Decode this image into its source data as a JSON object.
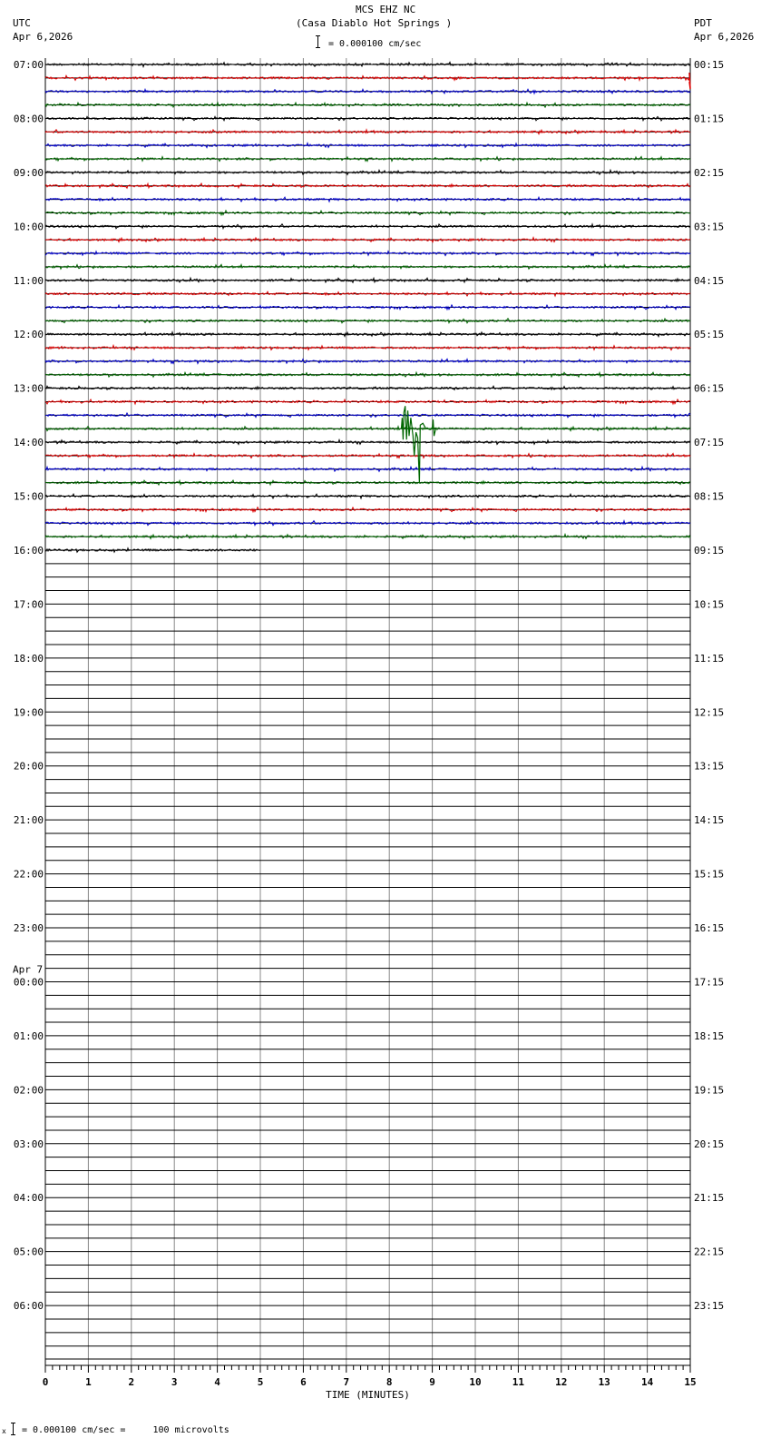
{
  "header": {
    "title": "MCS EHZ NC",
    "subtitle": "(Casa Diablo Hot Springs )",
    "scale": "= 0.000100 cm/sec",
    "left_tz": "UTC",
    "left_date": "Apr 6,2026",
    "right_tz": "PDT",
    "right_date": "Apr 6,2026"
  },
  "footer": {
    "scale_note": "= 0.000100 cm/sec =     100 microvolts",
    "marker": "x"
  },
  "chart_data": {
    "type": "line",
    "title": "MCS EHZ NC (Casa Diablo Hot Springs )",
    "xlabel": "TIME (MINUTES)",
    "xlim": [
      0,
      15
    ],
    "x_ticks": [
      "0",
      "1",
      "2",
      "3",
      "4",
      "5",
      "6",
      "7",
      "8",
      "9",
      "10",
      "11",
      "12",
      "13",
      "14",
      "15"
    ],
    "rows_per_hour": 4,
    "left_hour_labels": [
      "07:00",
      "08:00",
      "09:00",
      "10:00",
      "11:00",
      "12:00",
      "13:00",
      "14:00",
      "15:00",
      "16:00",
      "17:00",
      "18:00",
      "19:00",
      "20:00",
      "21:00",
      "22:00",
      "23:00",
      "00:00",
      "01:00",
      "02:00",
      "03:00",
      "04:00",
      "05:00",
      "06:00"
    ],
    "right_hour_labels": [
      "00:15",
      "01:15",
      "02:15",
      "03:15",
      "04:15",
      "05:15",
      "06:15",
      "07:15",
      "08:15",
      "09:15",
      "10:15",
      "11:15",
      "12:15",
      "13:15",
      "14:15",
      "15:15",
      "16:15",
      "17:15",
      "18:15",
      "19:15",
      "20:15",
      "21:15",
      "22:15",
      "23:15"
    ],
    "date_change_label": "Apr 7",
    "date_change_hour_index": 17,
    "trace_colors": [
      "#000000",
      "#dd0000",
      "#0000cc",
      "#006600"
    ],
    "rows_recorded": 37,
    "last_row_minutes": 5.0,
    "events": [
      {
        "row_utc": "13:45",
        "start_minute": 8.3,
        "end_minute": 9.1,
        "peak_amplitude": "large"
      },
      {
        "row_utc": "07:00",
        "start_minute": 14.95,
        "end_minute": 15,
        "peak_amplitude": "small"
      }
    ]
  }
}
